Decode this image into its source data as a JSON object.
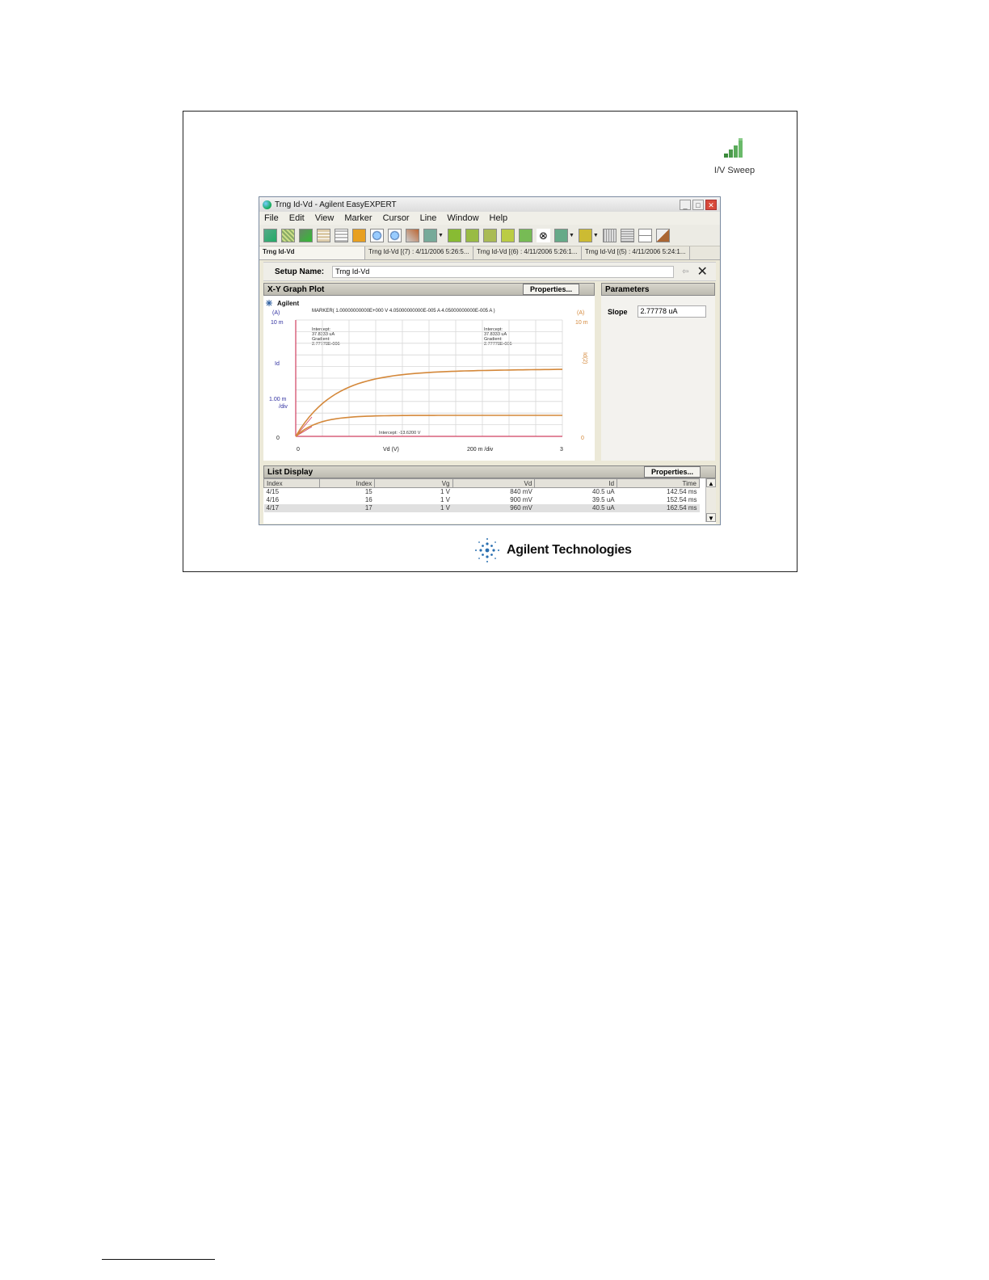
{
  "desktop_icon": {
    "label": "I/V Sweep",
    "icon": "iv-sweep-icon"
  },
  "window": {
    "title": "Trng Id-Vd - Agilent EasyEXPERT",
    "menu": [
      "File",
      "Edit",
      "View",
      "Marker",
      "Cursor",
      "Line",
      "Window",
      "Help"
    ]
  },
  "tabs": [
    "Trng Id-Vd",
    "Trng Id-Vd [(7) : 4/11/2006 5:26:5...",
    "Trng Id-Vd [(6) : 4/11/2006 5:26:1...",
    "Trng Id-Vd [(5) : 4/11/2006 5:24:1..."
  ],
  "setup": {
    "label": "Setup Name:",
    "value": "Trng Id-Vd"
  },
  "graph": {
    "header": "X-Y Graph Plot",
    "properties_label": "Properties...",
    "brand": "Agilent",
    "marker_text": "MARKER(  1.00000000000E+000 V    4.05000000000E-005 A    4.05000000000E-005 A )",
    "left_unit": "(A)",
    "right_unit": "(A)",
    "left_top": "10 m",
    "right_top": "10 m",
    "left_mid": "Id",
    "left_div": "1.00 m",
    "left_div2": "/div",
    "right_mid": "Id(2)",
    "left_zero": "0",
    "right_zero": "0",
    "x_zero": "0",
    "x_label": "Vd  (V)",
    "x_div": "200 m /div",
    "x_end": "3",
    "annot_left": [
      "Intercept:",
      "37.8333 uA",
      "Gradient:",
      "2.77778E-006"
    ],
    "annot_right": [
      "Intercept:",
      "37.8333 uA",
      "Gradient:",
      "2.77778E-006"
    ],
    "annot_bottom": "Intercept:     -13.6200 V"
  },
  "parameters": {
    "header": "Parameters",
    "slope_label": "Slope",
    "slope_value": "2.77778 uA"
  },
  "list": {
    "header": "List Display",
    "properties_label": "Properties...",
    "columns": [
      "Index",
      "Index",
      "Vg",
      "Vd",
      "Id",
      "Time"
    ],
    "rows": [
      [
        "4/15",
        "15",
        "1 V",
        "840 mV",
        "40.5 uA",
        "142.54 ms"
      ],
      [
        "4/16",
        "16",
        "1 V",
        "900 mV",
        "39.5 uA",
        "152.54 ms"
      ],
      [
        "4/17",
        "17",
        "1 V",
        "960 mV",
        "40.5 uA",
        "162.54 ms"
      ]
    ]
  },
  "logo_text": "Agilent Technologies",
  "colors": {
    "curve": "#d4883a",
    "axis_red": "#d04060",
    "grid": "#d8d8d8",
    "blue_label": "#3030a0"
  }
}
